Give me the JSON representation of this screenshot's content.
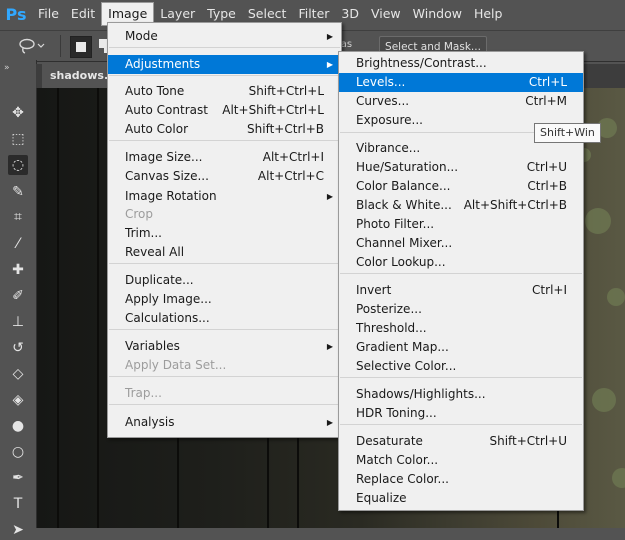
{
  "app_logo": "Ps",
  "menubar": [
    "File",
    "Edit",
    "Image",
    "Layer",
    "Type",
    "Select",
    "Filter",
    "3D",
    "View",
    "Window",
    "Help"
  ],
  "options_bar": {
    "anti_alias_label": "ias",
    "select_mask_label": "Select and Mask..."
  },
  "document_tab": "shadows.p",
  "toolbar_collapse": "»",
  "tools": [
    {
      "icon": "move-icon",
      "glyph": "✥"
    },
    {
      "icon": "marquee-icon",
      "glyph": "⬚"
    },
    {
      "icon": "lasso-icon",
      "glyph": "◌"
    },
    {
      "icon": "quick-selection-icon",
      "glyph": "✎"
    },
    {
      "icon": "crop-icon",
      "glyph": "⌗"
    },
    {
      "icon": "eyedropper-icon",
      "glyph": "⁄"
    },
    {
      "icon": "healing-brush-icon",
      "glyph": "✚"
    },
    {
      "icon": "brush-icon",
      "glyph": "✐"
    },
    {
      "icon": "clone-stamp-icon",
      "glyph": "⊥"
    },
    {
      "icon": "history-brush-icon",
      "glyph": "↺"
    },
    {
      "icon": "eraser-icon",
      "glyph": "◇"
    },
    {
      "icon": "paint-bucket-icon",
      "glyph": "◈"
    },
    {
      "icon": "blur-icon",
      "glyph": "●"
    },
    {
      "icon": "dodge-icon",
      "glyph": "○"
    },
    {
      "icon": "pen-icon",
      "glyph": "✒"
    },
    {
      "icon": "type-icon",
      "glyph": "T"
    },
    {
      "icon": "path-selection-icon",
      "glyph": "➤"
    }
  ],
  "image_menu": [
    {
      "label": "Mode",
      "shortcut": "",
      "submenu": true
    },
    {
      "label": "Adjustments",
      "shortcut": "",
      "submenu": true,
      "highlighted": true
    },
    {
      "label": "Auto Tone",
      "shortcut": "Shift+Ctrl+L"
    },
    {
      "label": "Auto Contrast",
      "shortcut": "Alt+Shift+Ctrl+L"
    },
    {
      "label": "Auto Color",
      "shortcut": "Shift+Ctrl+B"
    },
    {
      "label": "Image Size...",
      "shortcut": "Alt+Ctrl+I"
    },
    {
      "label": "Canvas Size...",
      "shortcut": "Alt+Ctrl+C"
    },
    {
      "label": "Image Rotation",
      "shortcut": "",
      "submenu": true
    },
    {
      "label": "Crop",
      "shortcut": "",
      "disabled": true
    },
    {
      "label": "Trim...",
      "shortcut": ""
    },
    {
      "label": "Reveal All",
      "shortcut": ""
    },
    {
      "label": "Duplicate...",
      "shortcut": ""
    },
    {
      "label": "Apply Image...",
      "shortcut": ""
    },
    {
      "label": "Calculations...",
      "shortcut": ""
    },
    {
      "label": "Variables",
      "shortcut": "",
      "submenu": true
    },
    {
      "label": "Apply Data Set...",
      "shortcut": "",
      "disabled": true
    },
    {
      "label": "Trap...",
      "shortcut": "",
      "disabled": true
    },
    {
      "label": "Analysis",
      "shortcut": "",
      "submenu": true
    }
  ],
  "adjustments_menu": [
    {
      "label": "Brightness/Contrast...",
      "shortcut": ""
    },
    {
      "label": "Levels...",
      "shortcut": "Ctrl+L",
      "highlighted": true
    },
    {
      "label": "Curves...",
      "shortcut": "Ctrl+M"
    },
    {
      "label": "Exposure...",
      "shortcut": ""
    },
    {
      "label": "Vibrance...",
      "shortcut": ""
    },
    {
      "label": "Hue/Saturation...",
      "shortcut": "Ctrl+U"
    },
    {
      "label": "Color Balance...",
      "shortcut": "Ctrl+B"
    },
    {
      "label": "Black & White...",
      "shortcut": "Alt+Shift+Ctrl+B"
    },
    {
      "label": "Photo Filter...",
      "shortcut": ""
    },
    {
      "label": "Channel Mixer...",
      "shortcut": ""
    },
    {
      "label": "Color Lookup...",
      "shortcut": ""
    },
    {
      "label": "Invert",
      "shortcut": "Ctrl+I"
    },
    {
      "label": "Posterize...",
      "shortcut": ""
    },
    {
      "label": "Threshold...",
      "shortcut": ""
    },
    {
      "label": "Gradient Map...",
      "shortcut": ""
    },
    {
      "label": "Selective Color...",
      "shortcut": ""
    },
    {
      "label": "Shadows/Highlights...",
      "shortcut": ""
    },
    {
      "label": "HDR Toning...",
      "shortcut": ""
    },
    {
      "label": "Desaturate",
      "shortcut": "Shift+Ctrl+U"
    },
    {
      "label": "Match Color...",
      "shortcut": ""
    },
    {
      "label": "Replace Color...",
      "shortcut": ""
    },
    {
      "label": "Equalize",
      "shortcut": ""
    }
  ],
  "tooltip": "Shift+Win",
  "colors": {
    "highlight": "#0078d7",
    "menu_bg": "#f0f0f0",
    "ui_bg": "#535353",
    "logo": "#31a8ff"
  }
}
